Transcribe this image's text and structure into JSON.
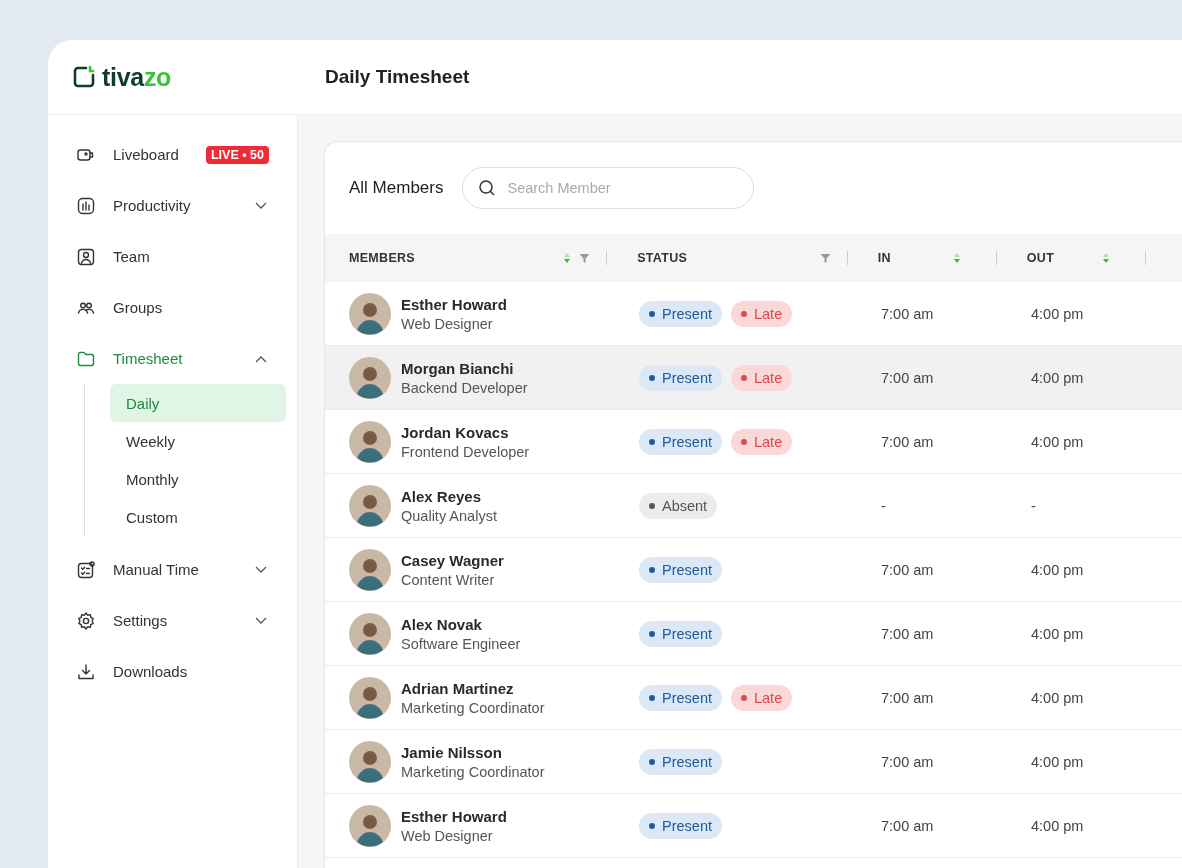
{
  "brand": {
    "name_dark": "tiva",
    "name_green": "zo"
  },
  "header": {
    "title": "Daily Timesheet"
  },
  "sidebar": {
    "items": [
      {
        "label": "Liveboard",
        "badge": "LIVE • 50",
        "selected": false
      },
      {
        "label": "Productivity",
        "expanded": false,
        "selected": false
      },
      {
        "label": "Team",
        "selected": false
      },
      {
        "label": "Groups",
        "selected": false
      },
      {
        "label": "Timesheet",
        "expanded": true,
        "selected": true,
        "children": [
          {
            "label": "Daily",
            "selected": true
          },
          {
            "label": "Weekly",
            "selected": false
          },
          {
            "label": "Monthly",
            "selected": false
          },
          {
            "label": "Custom",
            "selected": false
          }
        ]
      },
      {
        "label": "Manual Time",
        "expanded": false,
        "selected": false
      },
      {
        "label": "Settings",
        "expanded": false,
        "selected": false
      },
      {
        "label": "Downloads",
        "selected": false
      }
    ]
  },
  "toolbar": {
    "title": "All Members",
    "search": {
      "placeholder": "Search Member"
    }
  },
  "table": {
    "columns": [
      {
        "label": "MEMBERS",
        "sortable": true,
        "filterable": true
      },
      {
        "label": "STATUS",
        "sortable": false,
        "filterable": true
      },
      {
        "label": "IN",
        "sortable": true,
        "filterable": false
      },
      {
        "label": "OUT",
        "sortable": true,
        "filterable": false
      }
    ],
    "rows": [
      {
        "name": "Esther Howard",
        "role": "Web Designer",
        "status": [
          {
            "kind": "present",
            "label": "Present"
          },
          {
            "kind": "late",
            "label": "Late"
          }
        ],
        "in": "7:00 am",
        "out": "4:00 pm",
        "highlighted": false
      },
      {
        "name": "Morgan Bianchi",
        "role": "Backend Developer",
        "status": [
          {
            "kind": "present",
            "label": "Present"
          },
          {
            "kind": "late",
            "label": "Late"
          }
        ],
        "in": "7:00 am",
        "out": "4:00 pm",
        "highlighted": true
      },
      {
        "name": "Jordan Kovacs",
        "role": "Frontend Developer",
        "status": [
          {
            "kind": "present",
            "label": "Present"
          },
          {
            "kind": "late",
            "label": "Late"
          }
        ],
        "in": "7:00 am",
        "out": "4:00 pm",
        "highlighted": false
      },
      {
        "name": "Alex Reyes",
        "role": "Quality Analyst",
        "status": [
          {
            "kind": "absent",
            "label": "Absent"
          }
        ],
        "in": "-",
        "out": "-",
        "highlighted": false
      },
      {
        "name": "Casey Wagner",
        "role": "Content Writer",
        "status": [
          {
            "kind": "present",
            "label": "Present"
          }
        ],
        "in": "7:00 am",
        "out": "4:00 pm",
        "highlighted": false
      },
      {
        "name": "Alex Novak",
        "role": "Software Engineer",
        "status": [
          {
            "kind": "present",
            "label": "Present"
          }
        ],
        "in": "7:00 am",
        "out": "4:00 pm",
        "highlighted": false
      },
      {
        "name": "Adrian Martinez",
        "role": "Marketing Coordinator",
        "status": [
          {
            "kind": "present",
            "label": "Present"
          },
          {
            "kind": "late",
            "label": "Late"
          }
        ],
        "in": "7:00 am",
        "out": "4:00 pm",
        "highlighted": false
      },
      {
        "name": "Jamie Nilsson",
        "role": "Marketing Coordinator",
        "status": [
          {
            "kind": "present",
            "label": "Present"
          }
        ],
        "in": "7:00 am",
        "out": "4:00 pm",
        "highlighted": false
      },
      {
        "name": "Esther Howard",
        "role": "Web Designer",
        "status": [
          {
            "kind": "present",
            "label": "Present"
          }
        ],
        "in": "7:00 am",
        "out": "4:00 pm",
        "highlighted": false
      }
    ]
  }
}
